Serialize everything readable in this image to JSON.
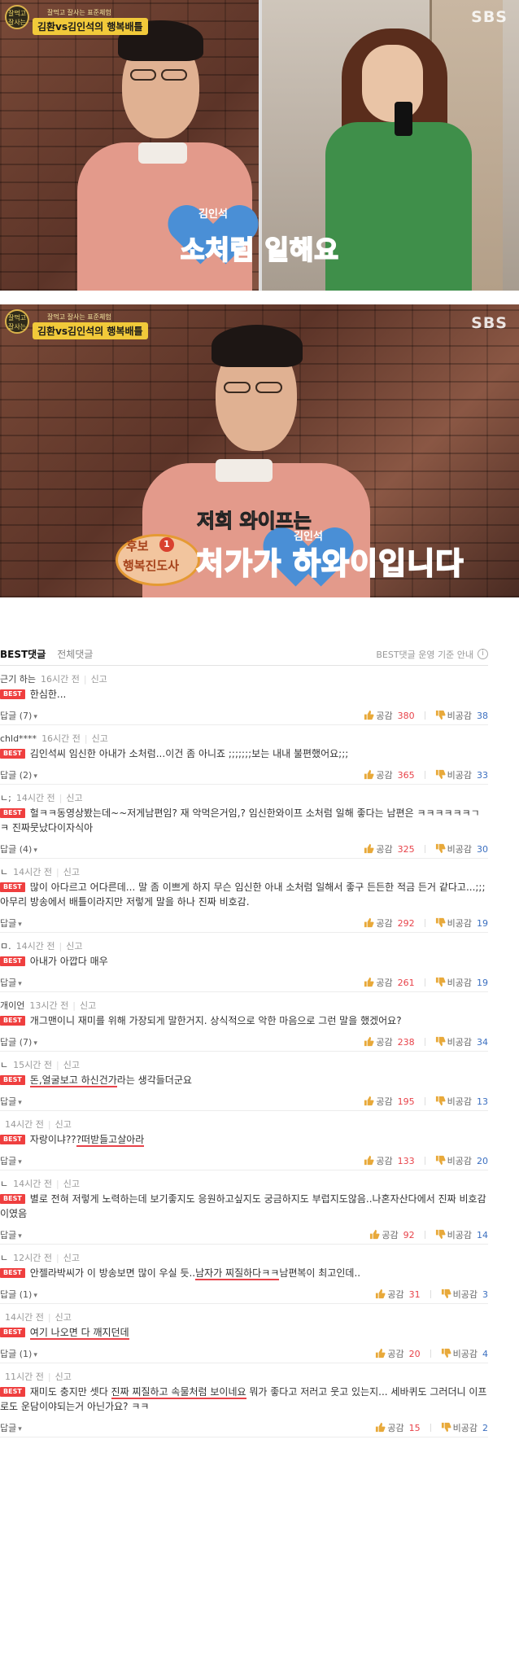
{
  "frame1": {
    "show_logo": "잘먹고\n잘사는",
    "show_sub": "잘먹고 잘사는 표준체험",
    "show_caption": "김환vs김인석의 행복배틀",
    "broadcaster": "SBS",
    "heart_name": "김인석",
    "subtitle": "소처럼 일해요"
  },
  "frame2": {
    "show_logo": "잘먹고\n잘사는",
    "show_sub": "잘먹고 잘사는 표준체험",
    "show_caption": "김환vs김인석의 행복배틀",
    "broadcaster": "SBS",
    "heart_name": "김인석",
    "badge_line1": "후보",
    "badge_number": "1",
    "badge_line2": "행복진도사",
    "subtitle_line1": "저희 와이프는",
    "subtitle_line2_a": "처가",
    "subtitle_line2_b": "가",
    "subtitle_line2_c": "하와이",
    "subtitle_line2_d": "입니다"
  },
  "comments_header": {
    "tab_best": "BEST댓글",
    "tab_all": "전체댓글",
    "guide": "BEST댓글 운영 기준 안내",
    "info_icon": "i"
  },
  "labels": {
    "report": "신고",
    "best": "BEST",
    "like": "공감",
    "dislike": "비공감"
  },
  "comments": [
    {
      "user": "근기 하는",
      "time": "16시간 전",
      "text": "한심한...",
      "highlight": "",
      "text_after": "",
      "reply": "답글 (7)",
      "likes": "380",
      "dislikes": "38"
    },
    {
      "user": "chld****",
      "time": "16시간 전",
      "text": "김인석씨 임신한 아내가 소처럼...이건 좀 아니죠 ;;;;;;;보는 내내 불편했어요;;;",
      "highlight": "",
      "text_after": "",
      "reply": "답글 (2)",
      "likes": "365",
      "dislikes": "33"
    },
    {
      "user": "ㄴ;",
      "time": "14시간 전",
      "text": "헐ㅋㅋ동영상봤는데~~저게남편임? 재 악먹은거임,? 임신한와이프 소처럼 일해 좋다는 남편은 ㅋㅋㅋㅋㅋㅋㄱㅋ 진짜뭇났다이자식아",
      "highlight": "",
      "text_after": "",
      "reply": "답글 (4)",
      "likes": "325",
      "dislikes": "30"
    },
    {
      "user": "ㄴ",
      "time": "14시간 전",
      "text": "많이 아다르고 어다른데... 말 좀 이쁘게 하지 무슨 임신한 아내 소처럼 일해서 좋구 든든한 적금 든거 같다고...;;; 아무리 방송에서 배틀이라지만 저렇게 말을 하나 진짜 비호감.",
      "highlight": "",
      "text_after": "",
      "reply": "답글",
      "likes": "292",
      "dislikes": "19"
    },
    {
      "user": "ㅁ.",
      "time": "14시간 전",
      "text": "아내가 아깝다 매우",
      "highlight": "",
      "text_after": "",
      "reply": "답글",
      "likes": "261",
      "dislikes": "19"
    },
    {
      "user": "개이언",
      "time": "13시간 전",
      "text": "개그맨이니 재미를 위해 가장되게 말한거지. 상식적으로 악한 마음으로 그런 말을 했겠어요?",
      "highlight": "",
      "text_after": "",
      "reply": "답글 (7)",
      "likes": "238",
      "dislikes": "34"
    },
    {
      "user": "ㄴ",
      "time": "15시간 전",
      "text": "",
      "highlight": "돈,얼굴보고 하신건가",
      "text_after": "라는 생각들더군요",
      "reply": "답글",
      "likes": "195",
      "dislikes": "13"
    },
    {
      "user": "",
      "time": "14시간 전",
      "text": "자랑이냐??",
      "highlight": "?떠받들고살아라",
      "text_after": "",
      "reply": "답글",
      "likes": "133",
      "dislikes": "20"
    },
    {
      "user": "ㄴ",
      "time": "14시간 전",
      "text": "별로 전혀 저렇게 노력하는데 보기좋지도 응원하고싶지도 궁금하지도 부럽지도않음..나혼자산다에서 진짜 비호감이였음",
      "highlight": "",
      "text_after": "",
      "reply": "답글",
      "likes": "92",
      "dislikes": "14"
    },
    {
      "user": "ㄴ",
      "time": "12시간 전",
      "text": "안젤라박씨가 이 방송보면 많이 우실 듯..",
      "highlight": "남자가 찌질하다ㅋㅋ",
      "text_after": "남편복이 최고인데..",
      "reply": "답글 (1)",
      "likes": "31",
      "dislikes": "3"
    },
    {
      "user": "",
      "time": "14시간 전",
      "text": "",
      "highlight": "여기 나오면 다 깨지던데",
      "text_after": "",
      "reply": "답글 (1)",
      "likes": "20",
      "dislikes": "4"
    },
    {
      "user": "",
      "time": "11시간 전",
      "text": "재미도 충지만 셋다 ",
      "highlight": "진짜 찌질하고 속물처럼 보이네요",
      "text_after": " 뭐가 좋다고 저러고 웃고 있는지... 세바퀴도 그러더니 이프로도 운담이야되는거 아닌가요? ㅋㅋ",
      "reply": "답글",
      "likes": "15",
      "dislikes": "2"
    }
  ],
  "colors": {
    "best_badge": "#ef3f3f",
    "like_count": "#e8434a",
    "dislike_count": "#3b6fc0",
    "underline": "#e8434a"
  }
}
